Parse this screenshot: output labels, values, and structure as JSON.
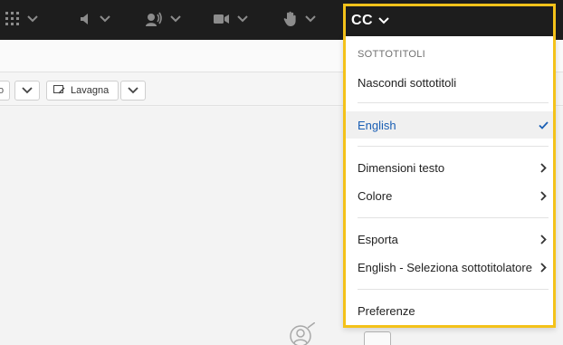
{
  "toolbar": {
    "icons": [
      "apps-grid-icon",
      "speaker-icon",
      "microphone-person-icon",
      "camera-icon",
      "raise-hand-icon"
    ],
    "cc_label": "CC"
  },
  "secondary_toolbar": {
    "partial_label": "o",
    "whiteboard_label": "Lavagna"
  },
  "captions_menu": {
    "section_title": "SOTTOTITOLI",
    "hide_captions": "Nascondi sottotitoli",
    "selected_language": "English",
    "text_size": "Dimensioni testo",
    "color": "Colore",
    "export": "Esporta",
    "select_captioner": "English - Seleziona sottotitolatore",
    "preferences": "Preferenze"
  },
  "colors": {
    "toolbar_bg": "#1d1d1d",
    "highlight_border": "#f4c21a",
    "selected_text": "#1a5fb4"
  }
}
